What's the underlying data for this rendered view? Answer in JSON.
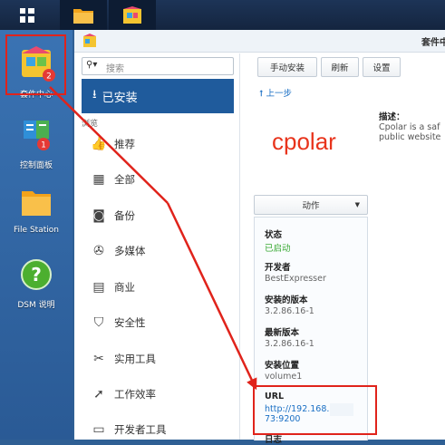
{
  "taskbar": {
    "main_menu_icon": "grid-menu-icon",
    "apps": [
      "folder-app-icon",
      "package-center-app-icon"
    ]
  },
  "desktop": {
    "icons": [
      {
        "label": "套件中心",
        "badge": "2"
      },
      {
        "label": "控制面板",
        "badge": "1"
      },
      {
        "label": "File Station"
      },
      {
        "label": "DSM 说明"
      }
    ]
  },
  "window": {
    "title": "套件中",
    "search_placeholder": "搜索",
    "installed_label": "已安装",
    "section_label": "浏览",
    "categories": [
      {
        "label": "推荐",
        "icon": "thumbs-up-icon"
      },
      {
        "label": "全部",
        "icon": "grid-icon"
      },
      {
        "label": "备份",
        "icon": "backup-icon"
      },
      {
        "label": "多媒体",
        "icon": "film-reel-icon"
      },
      {
        "label": "商业",
        "icon": "briefcase-icon"
      },
      {
        "label": "安全性",
        "icon": "shield-icon"
      },
      {
        "label": "实用工具",
        "icon": "tools-icon"
      },
      {
        "label": "工作效率",
        "icon": "rocket-icon"
      },
      {
        "label": "开发者工具",
        "icon": "dev-tools-icon"
      }
    ],
    "toolbar": {
      "manual_install": "手动安装",
      "refresh": "刷新",
      "settings": "设置"
    },
    "back_link": "上一步",
    "app": {
      "logo_text": "cpolar",
      "action_button": "动作",
      "description_label": "描述：",
      "description_lines": [
        "Cpolar is a saf",
        "public website"
      ]
    },
    "details": [
      {
        "label": "状态",
        "value": "已启动",
        "value_color": "#3aaa35"
      },
      {
        "label": "开发者",
        "value": "BestExpresser"
      },
      {
        "label": "安装的版本",
        "value": "3.2.86.16-1"
      },
      {
        "label": "最新版本",
        "value": "3.2.86.16-1"
      },
      {
        "label": "安装位置",
        "value": "volume1"
      },
      {
        "label": "URL",
        "value": "http://192.168.",
        "value_line2": "73:9200",
        "value_color": "#1a6fc4"
      },
      {
        "label": "日志"
      }
    ]
  },
  "annotations": {
    "color": "#e0231b"
  }
}
